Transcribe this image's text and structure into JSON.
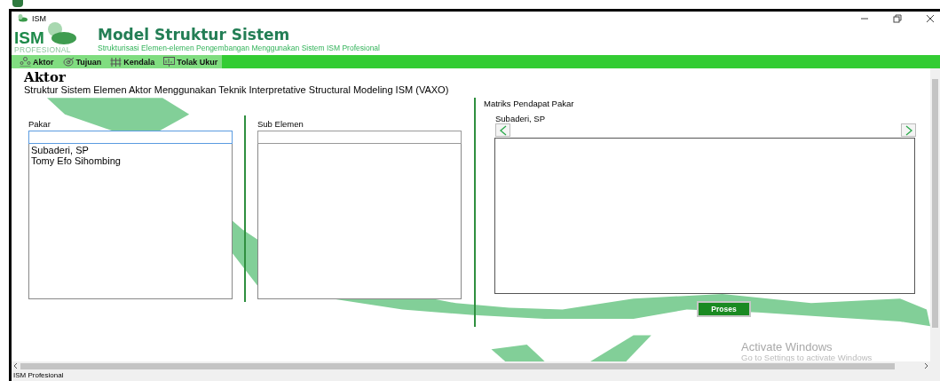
{
  "window": {
    "title": "ISM"
  },
  "header": {
    "logo_text": "ISM",
    "logo_subtext": "PROFESIONAL",
    "title": "Model Struktur Sistem",
    "subtitle": "Strukturisasi Elemen-elemen Pengembangan Menggunakan Sistem ISM Profesional"
  },
  "tabs": [
    {
      "label": "Aktor",
      "kind": "people"
    },
    {
      "label": "Tujuan",
      "kind": "target"
    },
    {
      "label": "Kendala",
      "kind": "barrier"
    },
    {
      "label": "Tolak Ukur",
      "kind": "chart"
    }
  ],
  "page": {
    "heading": "Aktor",
    "description": "Struktur Sistem Elemen Aktor  Menggunakan Teknik Interpretative Structural Modeling ISM (VAXO)"
  },
  "pakar": {
    "label": "Pakar",
    "items": [
      "Subaderi, SP",
      "Tomy Efo Sihombing"
    ]
  },
  "sub_elemen": {
    "label": "Sub Elemen"
  },
  "matriks": {
    "label": "Matriks Pendapat Pakar",
    "current_expert": "Subaderi, SP"
  },
  "process_button": "Proses",
  "overlay": {
    "line_1": "Activate Windows",
    "line_2": "Go to Settings to activate Windows"
  },
  "status_bar": "ISM Profesional"
}
